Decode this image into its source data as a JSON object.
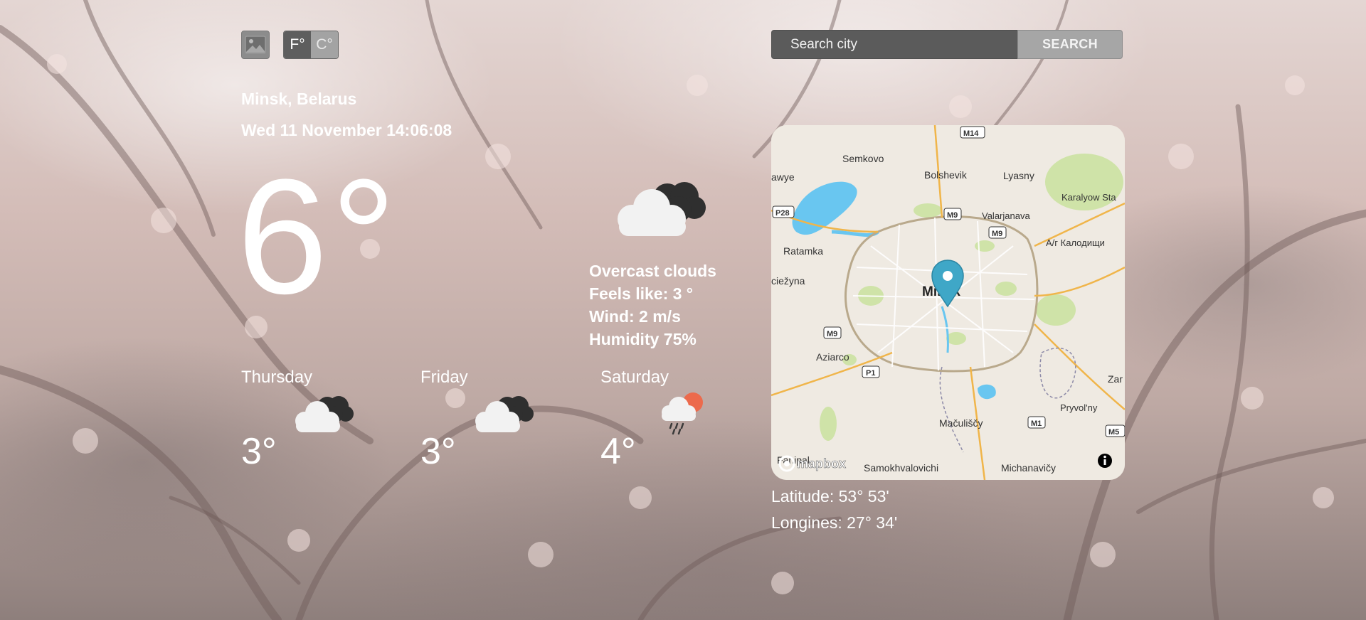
{
  "controls": {
    "bg_icon": "image-icon",
    "unit_f": "F°",
    "unit_c": "C°"
  },
  "search": {
    "placeholder": "Search city",
    "button_label": "SEARCH"
  },
  "current": {
    "location": "Minsk, Belarus",
    "datetime": "Wed 11 November 14:06:08",
    "temperature": "6°",
    "icon": "overcast-clouds-icon",
    "description": "Overcast clouds",
    "feels_like": "Feels like: 3 °",
    "wind": "Wind: 2 m/s",
    "humidity": "Humidity 75%"
  },
  "forecast": [
    {
      "day": "Thursday",
      "temp": "3°",
      "icon": "overcast-clouds-icon"
    },
    {
      "day": "Friday",
      "temp": "3°",
      "icon": "overcast-clouds-icon"
    },
    {
      "day": "Saturday",
      "temp": "4°",
      "icon": "rain-sun-cloud-icon"
    }
  ],
  "map": {
    "labels": {
      "m14": "M14",
      "semkovo": "Semkovo",
      "bolshevik": "Bolshevik",
      "lyasny": "Lyasny",
      "awye": "awye",
      "karalyow": "Karalyow Sta",
      "p28": "P28",
      "m9_top": "M9",
      "valarjanava": "Valarjanava",
      "m9_right": "M9",
      "kalodishchy": "А/г Калодищи",
      "ratamka": "Ratamka",
      "ciezyna": "ciežyna",
      "city": "Minsk",
      "m9_left": "M9",
      "aziarco": "Aziarco",
      "p1": "P1",
      "zar": "Zar",
      "pryvolny": "Pryvol'ny",
      "macuiscy": "Mačuliščy",
      "m1": "M1",
      "m5": "M5",
      "fanipal": "Fanipal",
      "samokhvalovichi": "Samokhvalovichi",
      "michanavicy": "Michanavičy",
      "logo": "mapbox"
    },
    "marker_icon": "map-pin-icon",
    "info_icon": "info-icon"
  },
  "coordinates": {
    "latitude": "Latitude: 53° 53'",
    "longitude": "Longines: 27° 34'"
  }
}
